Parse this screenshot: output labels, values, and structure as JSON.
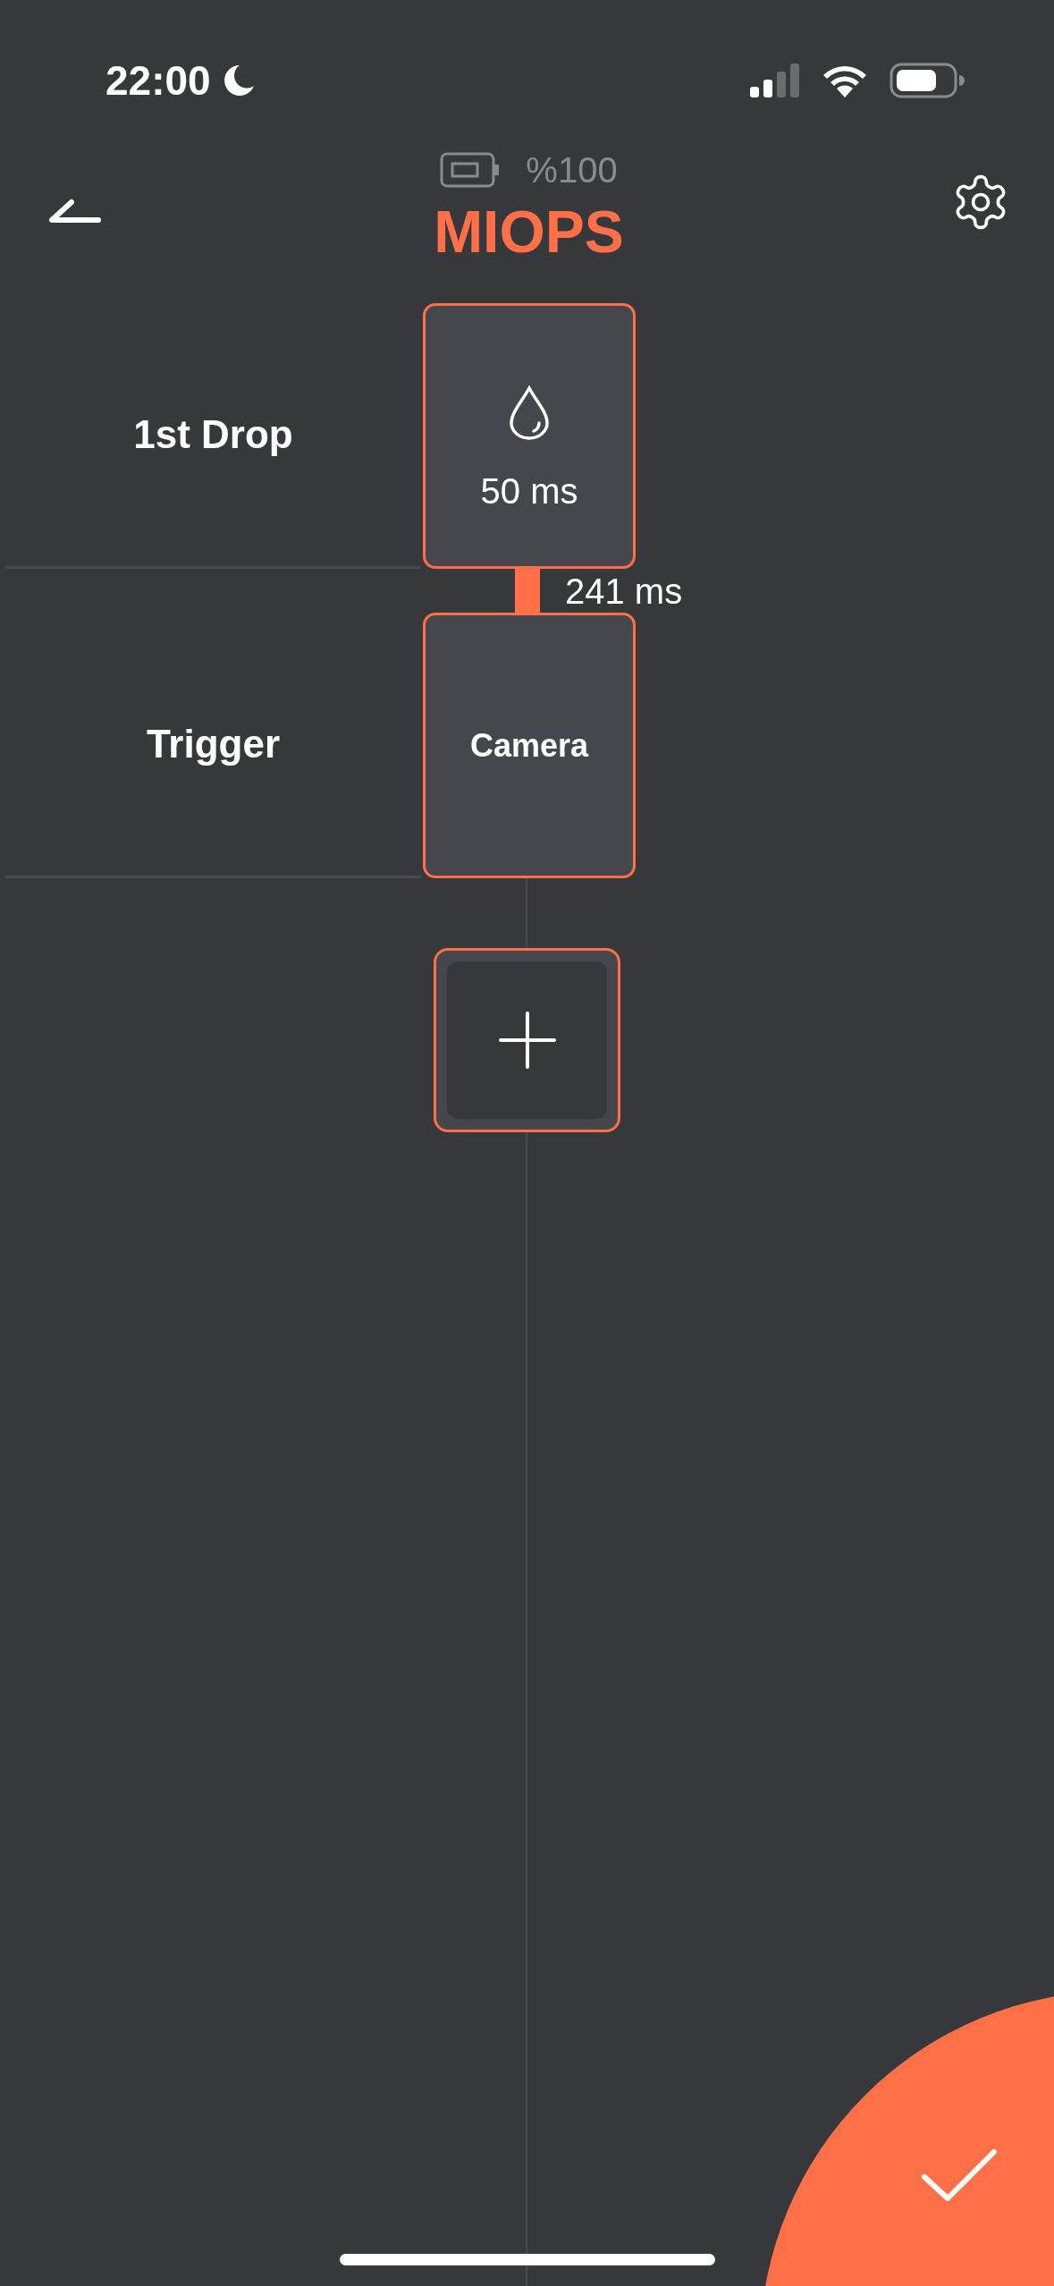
{
  "status_bar": {
    "time": "22:00"
  },
  "header": {
    "battery_text": "%100",
    "title": "MIOPS"
  },
  "rows": [
    {
      "label": "1st Drop",
      "kind": "drop",
      "value": "50 ms",
      "delay_after": "241 ms"
    },
    {
      "label": "Trigger",
      "kind": "camera",
      "value": "Camera"
    }
  ]
}
